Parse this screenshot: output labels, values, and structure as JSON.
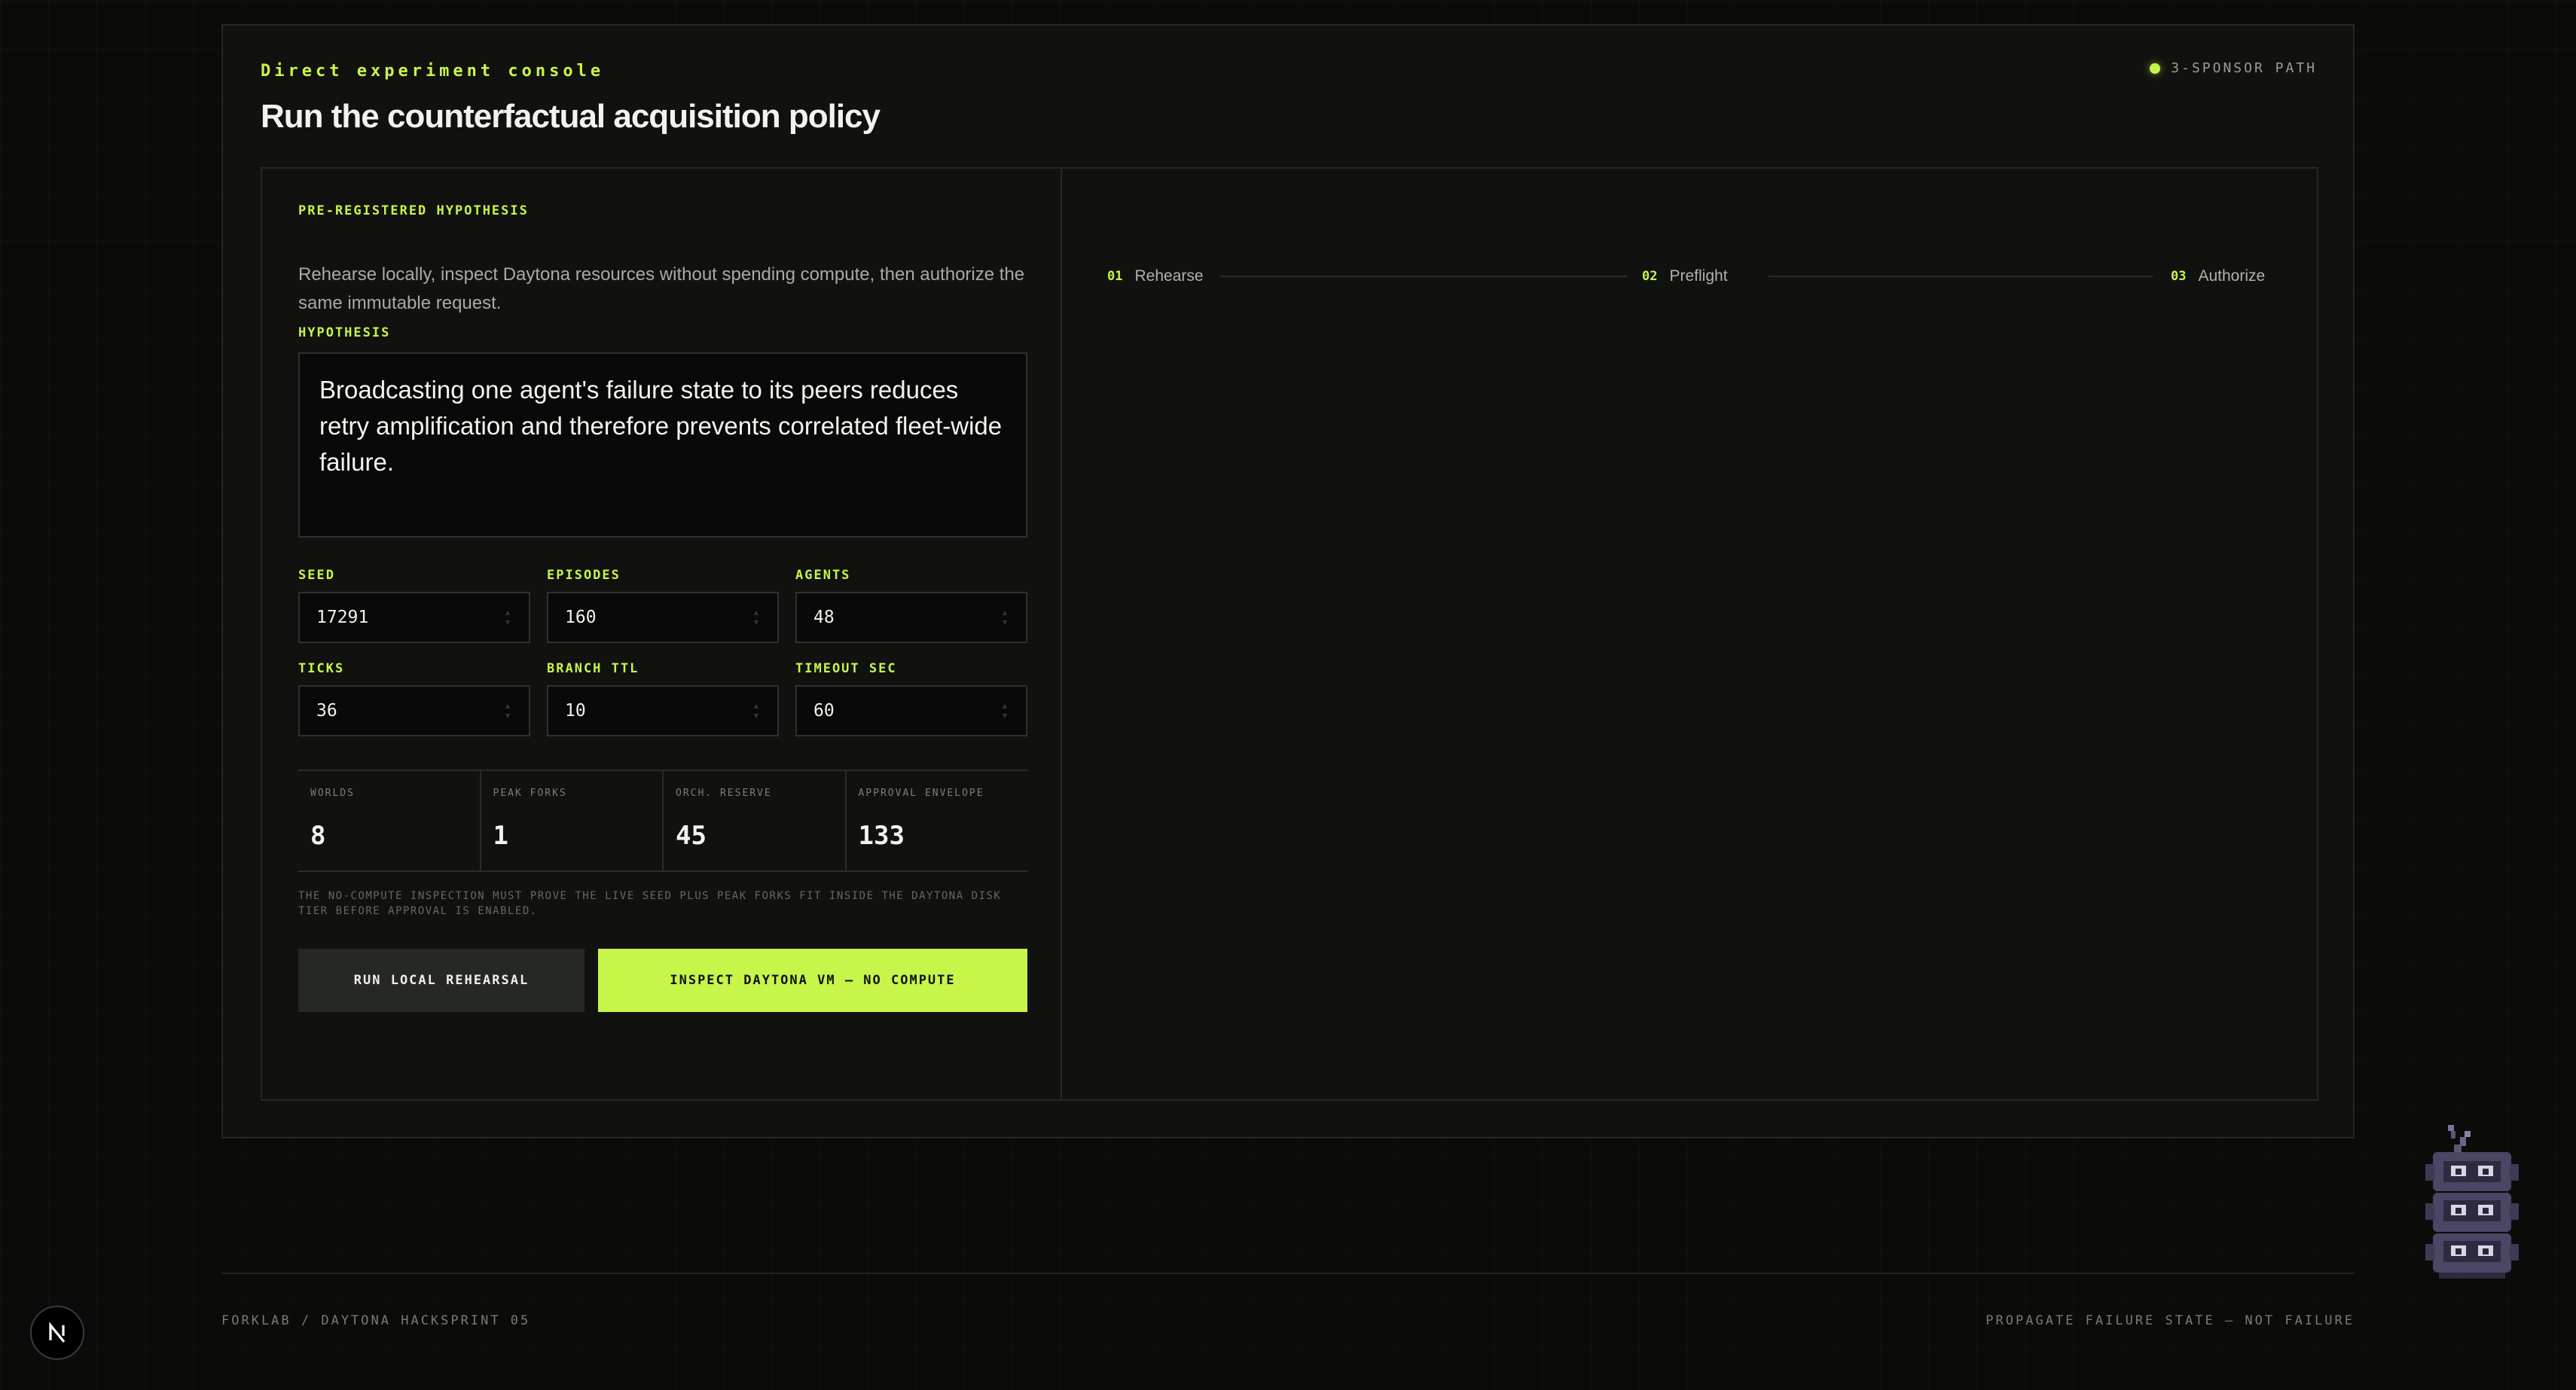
{
  "header": {
    "eyebrow": "Direct experiment console",
    "title": "Run the counterfactual acquisition policy",
    "sponsor_badge": "3-SPONSOR PATH"
  },
  "hypothesis_section": {
    "label": "PRE-REGISTERED HYPOTHESIS",
    "description": "Rehearse locally, inspect Daytona resources without spending compute, then authorize the same immutable request.",
    "hypothesis_label": "HYPOTHESIS",
    "hypothesis_text": "Broadcasting one agent's failure state to its peers reduces retry amplification and therefore prevents correlated fleet-wide failure."
  },
  "fields": {
    "seed": {
      "label": "SEED",
      "value": "17291"
    },
    "episodes": {
      "label": "EPISODES",
      "value": "160"
    },
    "agents": {
      "label": "AGENTS",
      "value": "48"
    },
    "ticks": {
      "label": "TICKS",
      "value": "36"
    },
    "branch_ttl": {
      "label": "BRANCH TTL",
      "value": "10"
    },
    "timeout_sec": {
      "label": "TIMEOUT SEC",
      "value": "60"
    }
  },
  "metrics": [
    {
      "label": "WORLDS",
      "value": "8"
    },
    {
      "label": "PEAK FORKS",
      "value": "1"
    },
    {
      "label": "ORCH. RESERVE",
      "value": "45"
    },
    {
      "label": "APPROVAL ENVELOPE",
      "value": "133"
    }
  ],
  "note": "THE NO-COMPUTE INSPECTION MUST PROVE THE LIVE SEED PLUS PEAK FORKS FIT INSIDE THE DAYTONA DISK TIER BEFORE APPROVAL IS ENABLED.",
  "buttons": {
    "rehearse": "RUN LOCAL REHEARSAL",
    "inspect": "INSPECT DAYTONA VM — NO COMPUTE"
  },
  "steps": [
    {
      "num": "01",
      "label": "Rehearse"
    },
    {
      "num": "02",
      "label": "Preflight"
    },
    {
      "num": "03",
      "label": "Authorize"
    }
  ],
  "footer": {
    "left": "FORKLAB / DAYTONA HACKSPRINT 05",
    "right": "PROPAGATE FAILURE STATE — NOT FAILURE"
  },
  "badge_letter": "N",
  "colors": {
    "accent": "#c8f54a",
    "background": "#0b0b0a",
    "panel": "#11120f",
    "border": "#262822"
  },
  "icons": [
    "status-dot-icon",
    "stepper-icon",
    "nextjs-logo-icon",
    "robot-mascot-icon"
  ]
}
